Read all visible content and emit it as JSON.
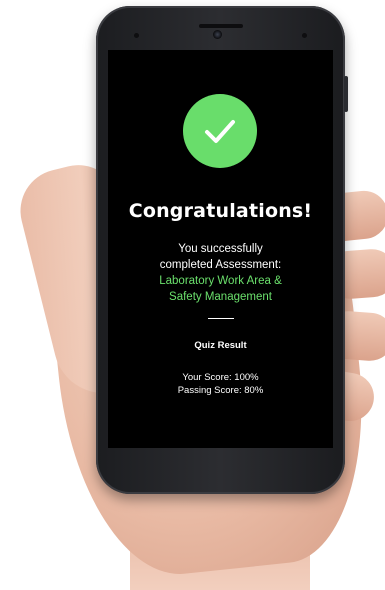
{
  "screen": {
    "success_icon": "check-icon",
    "title": "Congratulations!",
    "message_line1": "You successfully",
    "message_line2": "completed Assessment:",
    "assessment_line1": "Laboratory Work Area &",
    "assessment_line2": "Safety Management",
    "result_heading": "Quiz Result",
    "your_score": "Your Score: 100%",
    "passing_score": "Passing Score: 80%"
  },
  "colors": {
    "accent_green": "#69dd6b",
    "screen_bg": "#000000",
    "phone_body": "#2c2d31"
  }
}
